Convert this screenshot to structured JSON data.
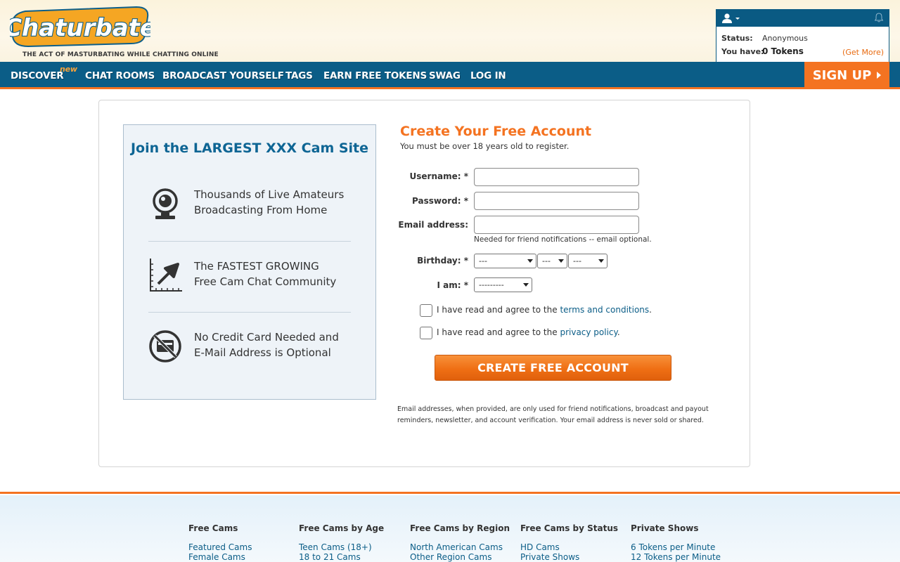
{
  "header": {
    "logo_text": "Chaturbate",
    "tagline": "THE ACT OF MASTURBATING WHILE CHATTING ONLINE",
    "userbox": {
      "status_label": "Status:",
      "status_value": "Anonymous",
      "have_label": "You have:",
      "tokens": "0 Tokens",
      "get_more": "(Get More)"
    }
  },
  "nav": {
    "items": [
      "DISCOVER",
      "CHAT ROOMS",
      "BROADCAST YOURSELF",
      "TAGS",
      "EARN FREE TOKENS",
      "SWAG",
      "LOG IN"
    ],
    "new_badge": "new",
    "signup": "SIGN UP"
  },
  "promo": {
    "title": "Join the LARGEST XXX Cam Site",
    "features": [
      {
        "line1": "Thousands of Live Amateurs",
        "line2": "Broadcasting From Home",
        "icon": "webcam-icon"
      },
      {
        "line1": "The FASTEST GROWING",
        "line2": "Free Cam Chat Community",
        "icon": "growth-chart-icon"
      },
      {
        "line1": "No Credit Card Needed and",
        "line2": "E-Mail Address is Optional",
        "icon": "no-credit-card-icon"
      }
    ]
  },
  "form": {
    "title": "Create Your Free Account",
    "subtitle": "You must be over 18 years old to register.",
    "username_label": "Username: *",
    "password_label": "Password: *",
    "email_label": "Email address:",
    "email_help": "Needed for friend notifications -- email optional.",
    "birthday_label": "Birthday: *",
    "birthday_month": "---",
    "birthday_day": "---",
    "birthday_year": "---",
    "gender_label": "I am: *",
    "gender_value": "---------",
    "agree_prefix": "I have read and agree to the",
    "terms_link": "terms and conditions",
    "privacy_link": "privacy policy",
    "submit": "CREATE FREE ACCOUNT",
    "disclaimer": "Email addresses, when provided, are only used for friend notifications, broadcast and payout reminders, newsletter, and account verification. Your email address is never sold or shared."
  },
  "footer": {
    "columns": [
      {
        "heading": "Free Cams",
        "links": [
          "Featured Cams",
          "Female Cams"
        ]
      },
      {
        "heading": "Free Cams by Age",
        "links": [
          "Teen Cams (18+)",
          "18 to 21 Cams"
        ]
      },
      {
        "heading": "Free Cams by Region",
        "links": [
          "North American Cams",
          "Other Region Cams"
        ]
      },
      {
        "heading": "Free Cams by Status",
        "links": [
          "HD Cams",
          "Private Shows"
        ]
      },
      {
        "heading": "Private Shows",
        "links": [
          "6 Tokens per Minute",
          "12 Tokens per Minute"
        ]
      }
    ]
  },
  "colors": {
    "brand_blue": "#0b5d87",
    "brand_orange": "#f47321"
  }
}
